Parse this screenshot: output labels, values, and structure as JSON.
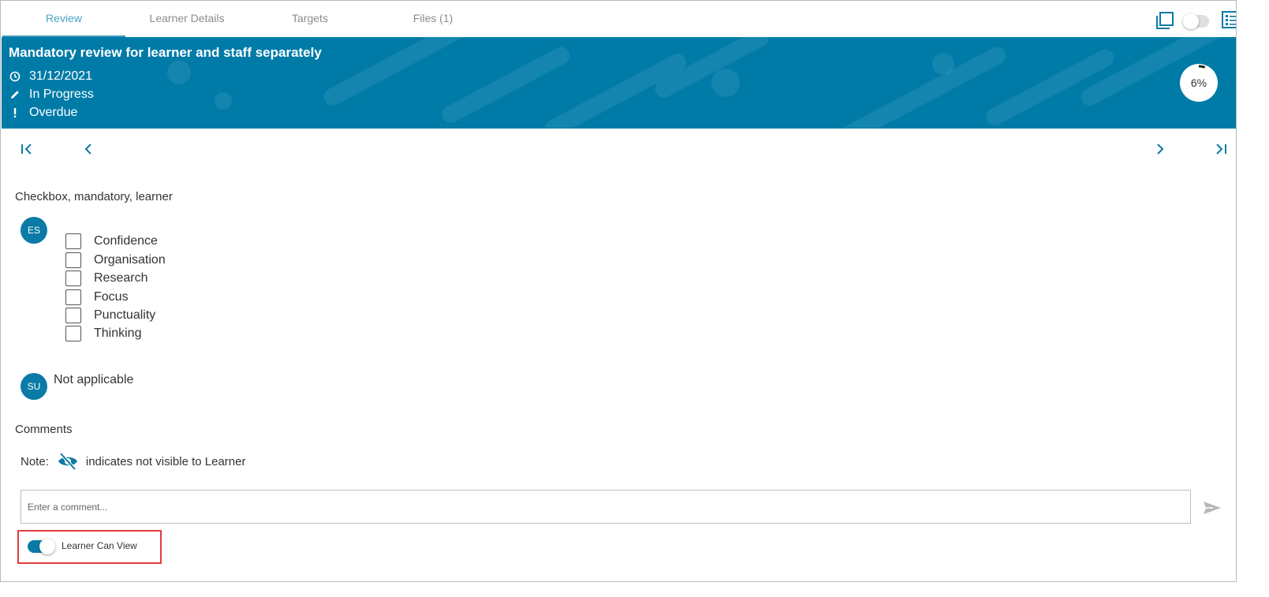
{
  "tabs": [
    {
      "label": "Review",
      "active": true
    },
    {
      "label": "Learner Details",
      "active": false
    },
    {
      "label": "Targets",
      "active": false
    },
    {
      "label": "Files (1)",
      "active": false
    }
  ],
  "header_controls": {
    "toggle_state": "off",
    "icons": [
      "copy-icon",
      "list-view-icon"
    ]
  },
  "banner": {
    "title": "Mandatory review for learner and staff separately",
    "date": "31/12/2021",
    "status": "In Progress",
    "due_state": "Overdue",
    "progress_label": "6%",
    "progress_value": 6,
    "background_color": "#007ba8"
  },
  "pager": {
    "icons": [
      "first-page-icon",
      "previous-page-icon",
      "next-page-icon",
      "last-page-icon"
    ]
  },
  "question": {
    "title": "Checkbox, mandatory, learner",
    "learner_response": {
      "avatar_initials": "ES",
      "options": [
        {
          "label": "Confidence",
          "checked": false
        },
        {
          "label": "Organisation",
          "checked": false
        },
        {
          "label": "Research",
          "checked": false
        },
        {
          "label": "Focus",
          "checked": false
        },
        {
          "label": "Punctuality",
          "checked": false
        },
        {
          "label": "Thinking",
          "checked": false
        }
      ]
    },
    "staff_response": {
      "avatar_initials": "SU",
      "text": "Not applicable"
    }
  },
  "comments": {
    "title": "Comments",
    "note_prefix": "Note:",
    "note_suffix": "indicates not visible to Learner",
    "input_placeholder": "Enter a comment...",
    "input_value": "",
    "learner_can_view_label": "Learner Can View",
    "learner_can_view": true
  },
  "colors": {
    "accent": "#0a7aa6",
    "active_tab": "#4aa3c4",
    "highlight_border": "#e23b3b"
  }
}
